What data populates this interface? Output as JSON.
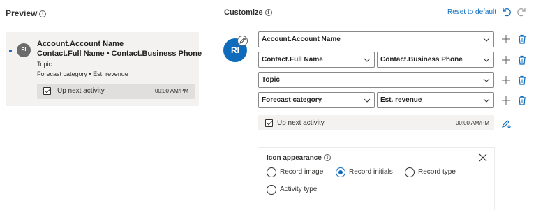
{
  "preview": {
    "title": "Preview",
    "card": {
      "avatar_initials": "RI",
      "line1": "Account.Account Name",
      "line2": "Contact.Full Name • Contact.Business Phone",
      "line3": "Topic",
      "line4": "Forecast category • Est. revenue",
      "activity_label": "Up next activity",
      "activity_time": "00:00 AM/PM"
    }
  },
  "customize": {
    "title": "Customize",
    "reset_label": "Reset to default",
    "avatar_initials": "RI",
    "rows": [
      {
        "fields": [
          "Account.Account Name"
        ]
      },
      {
        "fields": [
          "Contact.Full Name",
          "Contact.Business Phone"
        ]
      },
      {
        "fields": [
          "Topic"
        ]
      },
      {
        "fields": [
          "Forecast category",
          "Est. revenue"
        ]
      }
    ],
    "activity_label": "Up next activity",
    "activity_time": "00:00 AM/PM",
    "icon_appearance": {
      "title": "Icon appearance",
      "options": [
        "Record image",
        "Record initials",
        "Record type",
        "Activity type"
      ],
      "selected": "Record initials"
    }
  },
  "colors": {
    "accent": "#0f6cbd",
    "card_bg": "#f3f2f1",
    "preview_avatar": "#6b6b6b",
    "delete_icon": "#0f6cbd"
  },
  "icons": [
    "info-icon",
    "undo-icon",
    "redo-icon",
    "edit-icon",
    "chevron-down-icon",
    "plus-icon",
    "delete-icon",
    "paint-icon",
    "close-icon"
  ]
}
